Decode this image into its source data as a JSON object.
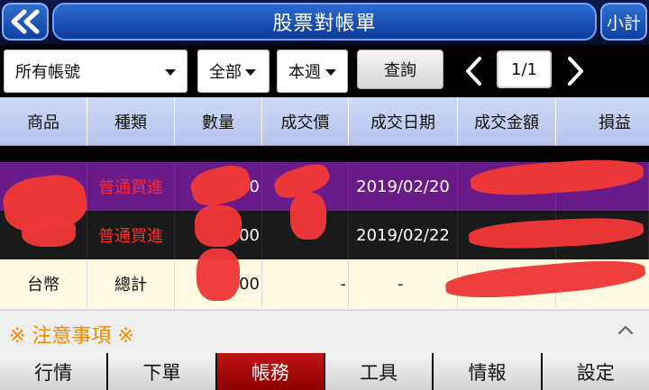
{
  "header": {
    "title": "股票對帳單",
    "subtotal_label": "小計"
  },
  "filters": {
    "account": "所有帳號",
    "category": "全部",
    "period": "本週",
    "query_label": "查詢",
    "page": "1/1"
  },
  "table": {
    "columns": [
      "商品",
      "種類",
      "數量",
      "成交價",
      "成交日期",
      "成交金額",
      "損益"
    ],
    "rows": [
      {
        "product": "",
        "type": "普通買進",
        "qty_suffix": "00",
        "price": "",
        "date": "2019/02/20",
        "amount": "",
        "pnl": ""
      },
      {
        "product": "",
        "type": "普通買進",
        "qty_suffix": "00",
        "price": "",
        "date": "2019/02/22",
        "amount": "",
        "pnl": ""
      }
    ],
    "total": {
      "product": "台幣",
      "type": "總計",
      "qty_suffix": "00",
      "price": "-",
      "date": "-",
      "amount": "",
      "pnl": ""
    }
  },
  "notice": {
    "label": "※ 注意事項 ※"
  },
  "bottom_nav": {
    "tabs": [
      "行情",
      "下單",
      "帳務",
      "工具",
      "情報",
      "設定"
    ],
    "active": "帳務"
  },
  "colors": {
    "header_blue": "#0d3b9a",
    "row_purple": "#6a1b8a",
    "row_dark": "#1a1a1a",
    "total_row": "#fffbe3",
    "notice_orange": "#f08a00",
    "active_tab": "#c01414",
    "buy_text": "#ff2a2a"
  }
}
